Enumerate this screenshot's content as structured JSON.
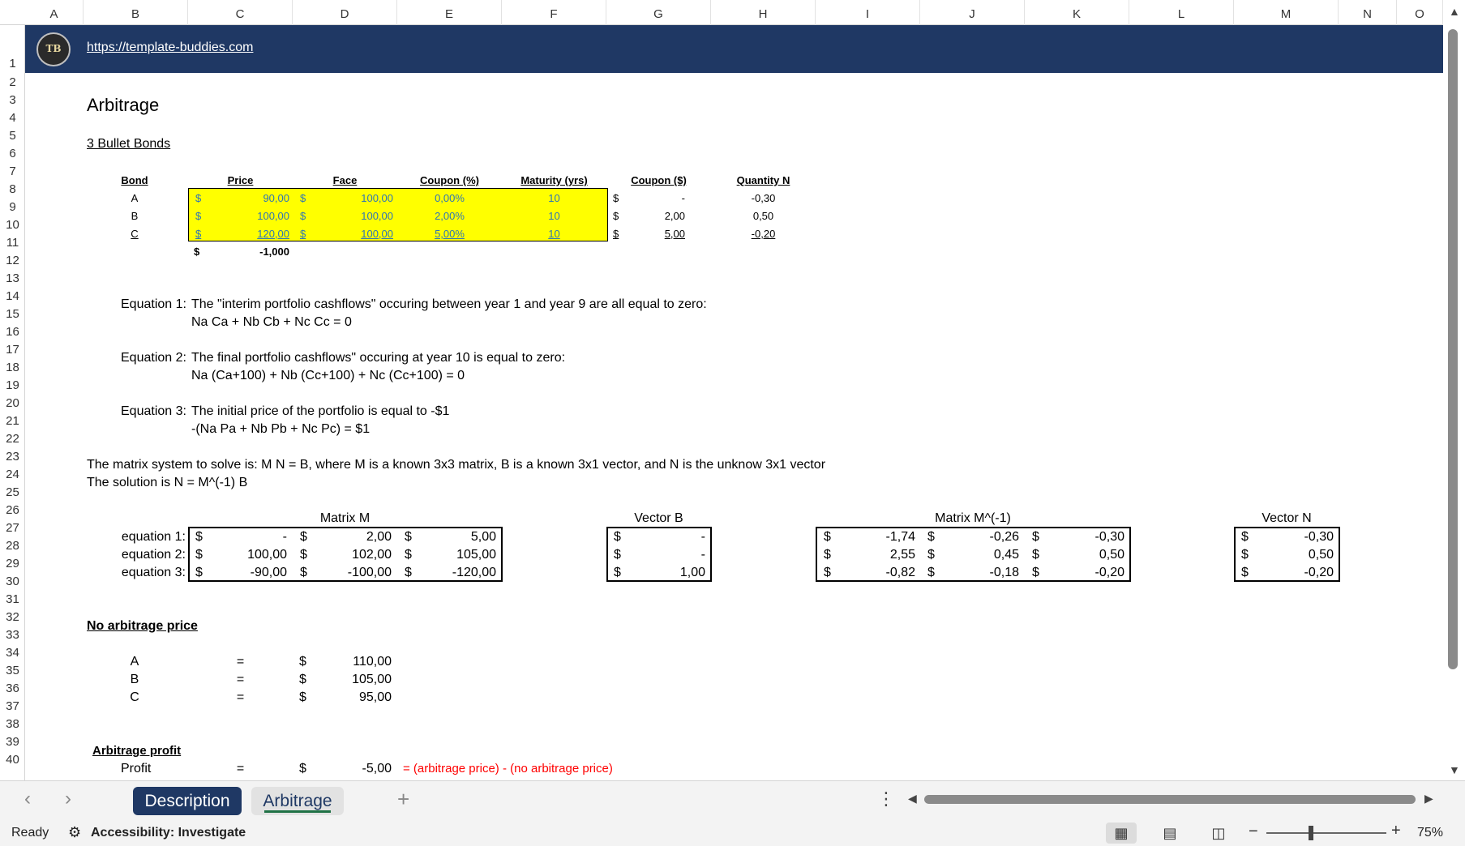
{
  "columns": [
    "A",
    "B",
    "C",
    "D",
    "E",
    "F",
    "G",
    "H",
    "I",
    "J",
    "K",
    "L",
    "M",
    "N",
    "O"
  ],
  "rows": [
    "1",
    "2",
    "3",
    "4",
    "5",
    "6",
    "7",
    "8",
    "9",
    "10",
    "11",
    "12",
    "13",
    "14",
    "15",
    "16",
    "17",
    "18",
    "19",
    "20",
    "21",
    "22",
    "23",
    "24",
    "25",
    "26",
    "27",
    "28",
    "29",
    "30",
    "31",
    "32",
    "33",
    "34",
    "35",
    "36",
    "37",
    "38",
    "39",
    "40"
  ],
  "banner": {
    "logo": "TB",
    "link": "https://template-buddies.com"
  },
  "title": "Arbitrage",
  "subtitle": "3 Bullet Bonds",
  "bond_table": {
    "headers": {
      "bond": "Bond",
      "price": "Price",
      "face": "Face",
      "coupon_pct": "Coupon (%)",
      "maturity": "Maturity (yrs)",
      "coupon_usd": "Coupon ($)",
      "quantity": "Quantity N"
    },
    "currency": "$",
    "rows": [
      {
        "bond": "A",
        "price": "90,00",
        "face": "100,00",
        "coupon_pct": "0,00%",
        "maturity": "10",
        "coupon_usd": "-",
        "quantity": "-0,30"
      },
      {
        "bond": "B",
        "price": "100,00",
        "face": "100,00",
        "coupon_pct": "2,00%",
        "maturity": "10",
        "coupon_usd": "2,00",
        "quantity": "0,50"
      },
      {
        "bond": "C",
        "price": "120,00",
        "face": "100,00",
        "coupon_pct": "5,00%",
        "maturity": "10",
        "coupon_usd": "5,00",
        "quantity": "-0,20"
      }
    ],
    "total": "-1,000"
  },
  "equations": [
    {
      "label": "Equation 1:",
      "line1": "The \"interim portfolio cashflows\" occuring between year 1 and year 9 are all equal to zero:",
      "line2": "Na Ca + Nb Cb + Nc Cc = 0"
    },
    {
      "label": "Equation 2:",
      "line1": "The final portfolio cashflows\" occuring at year 10 is equal to zero:",
      "line2": "Na (Ca+100) + Nb (Cc+100) + Nc (Cc+100) = 0"
    },
    {
      "label": "Equation 3:",
      "line1": "The initial price of the portfolio is equal to -$1",
      "line2": "-(Na Pa + Nb Pb + Nc Pc) = $1"
    }
  ],
  "matrix_note": {
    "line1": "The matrix system to solve is: M N = B, where M is a known 3x3 matrix, B is a known 3x1 vector, and N is the unknow 3x1 vector",
    "line2": "The solution is N = M^(-1) B"
  },
  "matrix_m": {
    "title": "Matrix M",
    "row_labels": [
      "equation 1:",
      "equation 2:",
      "equation 3:"
    ],
    "values": [
      [
        "-",
        "2,00",
        "5,00"
      ],
      [
        "100,00",
        "102,00",
        "105,00"
      ],
      [
        "-90,00",
        "-100,00",
        "-120,00"
      ]
    ]
  },
  "vector_b": {
    "title": "Vector B",
    "values": [
      "-",
      "-",
      "1,00"
    ]
  },
  "matrix_minv": {
    "title": "Matrix M^(-1)",
    "values": [
      [
        "-1,74",
        "-0,26",
        "-0,30"
      ],
      [
        "2,55",
        "0,45",
        "0,50"
      ],
      [
        "-0,82",
        "-0,18",
        "-0,20"
      ]
    ]
  },
  "vector_n": {
    "title": "Vector N",
    "values": [
      "-0,30",
      "0,50",
      "-0,20"
    ]
  },
  "no_arb": {
    "heading": "No arbitrage price",
    "rows": [
      {
        "bond": "A",
        "eq": "=",
        "cur": "$",
        "value": "110,00"
      },
      {
        "bond": "B",
        "eq": "=",
        "cur": "$",
        "value": "105,00"
      },
      {
        "bond": "C",
        "eq": "=",
        "cur": "$",
        "value": "95,00"
      }
    ]
  },
  "arb_profit": {
    "heading": "Arbitrage profit",
    "label": "Profit",
    "eq": "=",
    "cur": "$",
    "value": "-5,00",
    "formula_note": "= (arbitrage price) - (no arbitrage price)"
  },
  "tabs": [
    "Description",
    "Arbitrage"
  ],
  "active_tab": "Arbitrage",
  "status": {
    "ready": "Ready",
    "accessibility": "Accessibility: Investigate",
    "zoom": "75%"
  },
  "colors": {
    "banner": "#1f3864",
    "highlight": "#ffff00",
    "input_blue": "#2e75b6",
    "note_red": "#ff0000"
  }
}
